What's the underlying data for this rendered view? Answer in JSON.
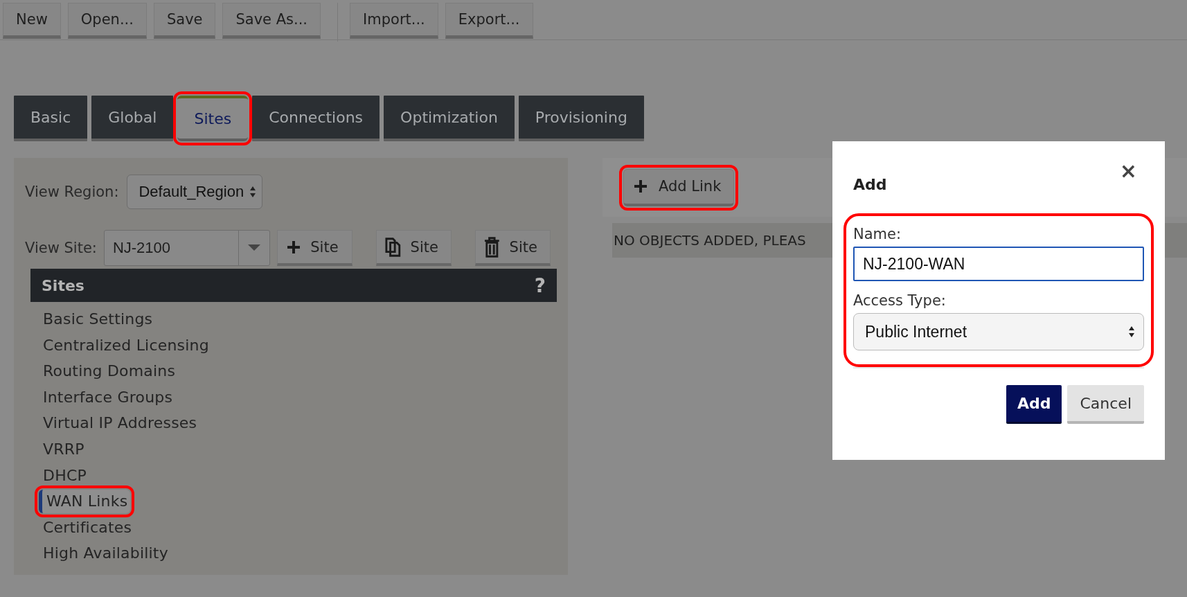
{
  "toolbar": [
    {
      "buttons": [
        {
          "label": "New"
        },
        {
          "label": "Open..."
        },
        {
          "label": "Save"
        },
        {
          "label": "Save As..."
        }
      ]
    },
    {
      "buttons": [
        {
          "label": "Import..."
        },
        {
          "label": "Export..."
        }
      ]
    }
  ],
  "tabs": [
    {
      "label": "Basic",
      "selected": false,
      "highlighted": false
    },
    {
      "label": "Global",
      "selected": false,
      "highlighted": false
    },
    {
      "label": "Sites",
      "selected": true,
      "highlighted": true
    },
    {
      "label": "Connections",
      "selected": false,
      "highlighted": false
    },
    {
      "label": "Optimization",
      "selected": false,
      "highlighted": false
    },
    {
      "label": "Provisioning",
      "selected": false,
      "highlighted": false
    }
  ],
  "left_panel": {
    "view_region": {
      "label": "View Region:",
      "value": "Default_Region"
    },
    "view_site": {
      "label": "View Site:",
      "value": "NJ-2100"
    },
    "site_actions": [
      {
        "kind": "add",
        "label": "Site"
      },
      {
        "kind": "copy",
        "label": "Site"
      },
      {
        "kind": "delete",
        "label": "Site"
      }
    ],
    "sites_header": {
      "title": "Sites",
      "help": "?"
    },
    "items": [
      {
        "label": "Basic Settings",
        "selected": false,
        "highlighted": false
      },
      {
        "label": "Centralized Licensing",
        "selected": false,
        "highlighted": false
      },
      {
        "label": "Routing Domains",
        "selected": false,
        "highlighted": false
      },
      {
        "label": "Interface Groups",
        "selected": false,
        "highlighted": false
      },
      {
        "label": "Virtual IP Addresses",
        "selected": false,
        "highlighted": false
      },
      {
        "label": "VRRP",
        "selected": false,
        "highlighted": false
      },
      {
        "label": "DHCP",
        "selected": false,
        "highlighted": false
      },
      {
        "label": "WAN Links",
        "selected": true,
        "highlighted": true
      },
      {
        "label": "Certificates",
        "selected": false,
        "highlighted": false
      },
      {
        "label": "High Availability",
        "selected": false,
        "highlighted": false
      }
    ]
  },
  "right_panel": {
    "add_link": {
      "label": "Add Link",
      "highlighted": true
    },
    "message": "NO OBJECTS ADDED, PLEAS"
  },
  "dialog": {
    "title": "Add",
    "close": "×",
    "fields_highlighted": true,
    "name": {
      "label": "Name:",
      "value": "NJ-2100-WAN"
    },
    "access_type": {
      "label": "Access Type:",
      "value": "Public Internet"
    },
    "buttons": [
      {
        "label": "Add",
        "kind": "primary"
      },
      {
        "label": "Cancel",
        "kind": "secondary"
      }
    ]
  }
}
